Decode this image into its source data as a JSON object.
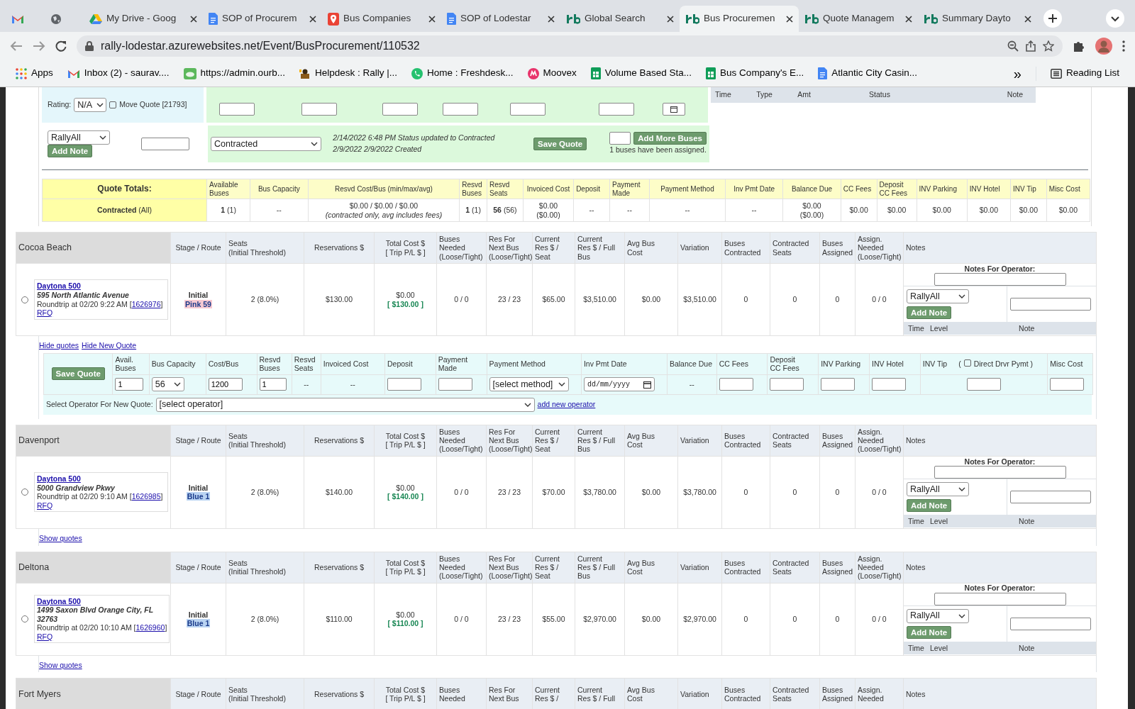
{
  "browser": {
    "tabs": [
      {
        "kind": "gmail",
        "selected": false
      },
      {
        "kind": "globe",
        "selected": false
      },
      {
        "kind": "drive",
        "title": "My Drive - Goog",
        "selected": false
      },
      {
        "kind": "docs",
        "title": "SOP of Procurem",
        "selected": false
      },
      {
        "kind": "maps",
        "title": "Bus Companies",
        "selected": false
      },
      {
        "kind": "docs",
        "title": "SOP of Lodestar",
        "selected": false
      },
      {
        "kind": "rb",
        "title": "Global Search",
        "selected": false
      },
      {
        "kind": "rb",
        "title": "Bus Procuremen",
        "selected": true
      },
      {
        "kind": "rb",
        "title": "Quote Managem",
        "selected": false
      },
      {
        "kind": "rb",
        "title": "Summary Dayto",
        "selected": false
      }
    ],
    "url": "rally-lodestar.azurewebsites.net/Event/BusProcurement/110532",
    "bookmarks": [
      {
        "kind": "apps",
        "label": "Apps"
      },
      {
        "kind": "gmail",
        "label": "Inbox (2) - saurav...."
      },
      {
        "kind": "green",
        "label": "https://admin.ourb..."
      },
      {
        "kind": "helpdesk",
        "label": "Helpdesk : Rally |..."
      },
      {
        "kind": "phone",
        "label": "Home : Freshdesk..."
      },
      {
        "kind": "moovex",
        "label": "Moovex"
      },
      {
        "kind": "sheet",
        "label": "Volume Based Sta..."
      },
      {
        "kind": "sheet",
        "label": "Bus Company's E..."
      },
      {
        "kind": "docs",
        "label": "Atlantic City Casin..."
      }
    ],
    "bookmarks_more": "»",
    "reading_list": "Reading List"
  },
  "quote": {
    "rating_label": "Rating:",
    "rating": "N/A",
    "move_quote": {
      "label": "Move Quote [21793]",
      "checked": false
    },
    "log_columns": [
      "Time",
      "Type",
      "Amt",
      "Status",
      "Note"
    ],
    "operator": "RallyAll",
    "add_note": "Add Note",
    "status": "Contracted",
    "status_log": [
      "2/14/2022 6:48 PM Status updated to Contracted",
      "2/9/2022 2/9/2022 Created"
    ],
    "save": "Save Quote",
    "add_buses": "Add More Buses",
    "assigned": "1 buses have been assigned."
  },
  "totals": {
    "title": "Quote Totals:",
    "status": "**Contracted** (All)",
    "columns": [
      {
        "label": "Available\nBuses",
        "value": "**1** (1)"
      },
      {
        "label": "Bus Capacity",
        "value": "--"
      },
      {
        "label": "Resvd Cost/Bus (min/max/avg)",
        "value": "$0.00 / $0.00 / $0.00\n*(contracted only, avg includes fees)*"
      },
      {
        "label": "Resvd\nBuses",
        "value": "**1** (1)"
      },
      {
        "label": "Resvd\nSeats",
        "value": "**56** (56)"
      },
      {
        "label": "Invoiced Cost",
        "value": "$0.00\n($0.00)"
      },
      {
        "label": "Deposit",
        "value": "--"
      },
      {
        "label": "Payment\nMade",
        "value": "--"
      },
      {
        "label": "Payment Method",
        "value": "--"
      },
      {
        "label": "Inv Pmt Date",
        "value": "--"
      },
      {
        "label": "Balance Due",
        "value": "$0.00\n($0.00)"
      },
      {
        "label": "CC Fees",
        "value": "$0.00"
      },
      {
        "label": "Deposit\nCC Fees",
        "value": "$0.00"
      },
      {
        "label": "INV Parking",
        "value": "$0.00"
      },
      {
        "label": "INV Hotel",
        "value": "$0.00"
      },
      {
        "label": "INV Tip",
        "value": "$0.00"
      },
      {
        "label": "Misc Cost",
        "value": "$0.00"
      }
    ]
  },
  "sections": [
    {
      "name": "Cocoa Beach",
      "columns": [
        "Stage / Route",
        "Seats\n(Initial Threshold)",
        "Reservations $",
        "Total Cost $\n[ Trip P/L $ ]",
        "Buses\nNeeded\n(Loose/Tight)",
        "Res For\nNext Bus\n(Loose/Tight)",
        "Current\nRes $ /\nSeat",
        "Current\nRes $ / Full\nBus",
        "Avg Bus\nCost",
        "Variation",
        "Buses\nContracted",
        "Contracted\nSeats",
        "Buses\nAssigned",
        "Assign.\nNeeded\n(Loose/Tight)",
        "Notes"
      ],
      "row": {
        "selected": false,
        "event": "Daytona 500",
        "address": "595 North Atlantic Avenue",
        "trip": "Roundtrip at 02/20 9:22 AM [",
        "trip_id": "1626976",
        "trip_end": "]",
        "rfq": "RFQ",
        "stage": "Initial",
        "route": "Pink 59",
        "color": "#f6c9d2",
        "values": [
          "2 (8.0%)",
          "$130.00"
        ],
        "total_cost": "$0.00",
        "trip_pl": "[ $130.00 ]",
        "values2": [
          "0 / 0",
          "23 / 23",
          "$65.00",
          "$3,510.00",
          "$0.00",
          "$3,510.00",
          "0",
          "0",
          "0",
          "0 / 0"
        ],
        "notes": {
          "label": "Notes For Operator:",
          "operator": "RallyAll",
          "add_note": "Add Note",
          "columns": [
            "Time",
            "Level"
          ],
          "note_column": "Note"
        }
      },
      "links": [
        "Hide quotes",
        "Hide New Quote"
      ],
      "editor": {
        "save": "Save Quote",
        "columns": [
          {
            "label": "Avail.\nBuses",
            "kind": "input",
            "value": "1"
          },
          {
            "label": "Bus Capacity",
            "kind": "select",
            "value": "56"
          },
          {
            "label": "Cost/Bus",
            "kind": "input",
            "value": "1200"
          },
          {
            "label": "Resvd\nBuses",
            "kind": "input",
            "value": "1"
          },
          {
            "label": "Resvd\nSeats",
            "kind": "text",
            "value": "--"
          },
          {
            "label": "Invoiced Cost",
            "kind": "text",
            "value": "--"
          },
          {
            "label": "Deposit",
            "kind": "input"
          },
          {
            "label": "Payment\nMade",
            "kind": "input"
          },
          {
            "label": "Payment Method",
            "kind": "select",
            "value": "[select method]"
          },
          {
            "label": "Inv Pmt Date",
            "kind": "date",
            "placeholder": "dd/mm/yyyy"
          },
          {
            "label": "Balance Due",
            "kind": "text",
            "value": "--"
          },
          {
            "label": "CC Fees",
            "kind": "input"
          },
          {
            "label": "Deposit\nCC Fees",
            "kind": "input"
          },
          {
            "label": "INV Parking",
            "kind": "input"
          },
          {
            "label": "INV Hotel",
            "kind": "input"
          },
          {
            "label": "INV Tip",
            "kind": "input",
            "direct_pay": {
              "before": "(",
              "label": "Direct Drvr Pymt )",
              "checked": false
            }
          },
          {
            "label": "Misc Cost",
            "kind": "input"
          }
        ],
        "operator_label": "Select Operator For New Quote:",
        "operator": "[select operator]",
        "add_operator": "add new operator"
      }
    },
    {
      "name": "Davenport",
      "columns": [
        "Stage / Route",
        "Seats\n(Initial Threshold)",
        "Reservations $",
        "Total Cost $\n[ Trip P/L $ ]",
        "Buses\nNeeded\n(Loose/Tight)",
        "Res For\nNext Bus\n(Loose/Tight)",
        "Current\nRes $ /\nSeat",
        "Current\nRes $ / Full\nBus",
        "Avg Bus\nCost",
        "Variation",
        "Buses\nContracted",
        "Contracted\nSeats",
        "Buses\nAssigned",
        "Assign.\nNeeded\n(Loose/Tight)",
        "Notes"
      ],
      "row": {
        "selected": false,
        "event": "Daytona 500",
        "address": "5000 Grandview Pkwy",
        "trip": "Roundtrip at 02/20 9:10 AM [",
        "trip_id": "1626985",
        "trip_end": "]",
        "rfq": "RFQ",
        "stage": "Initial",
        "route": "Blue 1",
        "color": "#b9d3f2",
        "values": [
          "2 (8.0%)",
          "$140.00"
        ],
        "total_cost": "$0.00",
        "trip_pl": "[ $140.00 ]",
        "values2": [
          "0 / 0",
          "23 / 23",
          "$70.00",
          "$3,780.00",
          "$0.00",
          "$3,780.00",
          "0",
          "0",
          "0",
          "0 / 0"
        ],
        "notes": {
          "label": "Notes For Operator:",
          "operator": "RallyAll",
          "add_note": "Add Note",
          "columns": [
            "Time",
            "Level"
          ],
          "note_column": "Note"
        }
      },
      "links": [
        "Show quotes"
      ]
    },
    {
      "name": "Deltona",
      "columns": [
        "Stage / Route",
        "Seats\n(Initial Threshold)",
        "Reservations $",
        "Total Cost $\n[ Trip P/L $ ]",
        "Buses\nNeeded\n(Loose/Tight)",
        "Res For\nNext Bus\n(Loose/Tight)",
        "Current\nRes $ /\nSeat",
        "Current\nRes $ / Full\nBus",
        "Avg Bus\nCost",
        "Variation",
        "Buses\nContracted",
        "Contracted\nSeats",
        "Buses\nAssigned",
        "Assign.\nNeeded\n(Loose/Tight)",
        "Notes"
      ],
      "row": {
        "selected": false,
        "event": "Daytona 500",
        "address": "1499 Saxon Blvd Orange City, FL 32763",
        "trip": "Roundtrip at 02/20 10:10 AM [",
        "trip_id": "1626960",
        "trip_end": "]",
        "rfq": "RFQ",
        "stage": "Initial",
        "route": "Blue 1",
        "color": "#b9d3f2",
        "values": [
          "2 (8.0%)",
          "$110.00"
        ],
        "total_cost": "$0.00",
        "trip_pl": "[ $110.00 ]",
        "values2": [
          "0 / 0",
          "23 / 23",
          "$55.00",
          "$2,970.00",
          "$0.00",
          "$2,970.00",
          "0",
          "0",
          "0",
          "0 / 0"
        ],
        "notes": {
          "label": "Notes For Operator:",
          "operator": "RallyAll",
          "add_note": "Add Note",
          "columns": [
            "Time",
            "Level"
          ],
          "note_column": "Note"
        }
      },
      "links": [
        "Show quotes"
      ]
    },
    {
      "name": "Fort Myers",
      "columns": [
        "Stage / Route",
        "Seats\n(Initial Threshold)",
        "Reservations $",
        "Total Cost $\n[ Trip P/L $ ]",
        "Buses\nNeeded",
        "Res For\nNext Bus",
        "Current\nRes $ /",
        "Current\nRes $ / Full",
        "Avg Bus\nCost",
        "Variation",
        "Buses\nContracted",
        "Contracted\nSeats",
        "Buses\nAssigned",
        "Assign.\nNeeded",
        "Notes"
      ]
    }
  ]
}
